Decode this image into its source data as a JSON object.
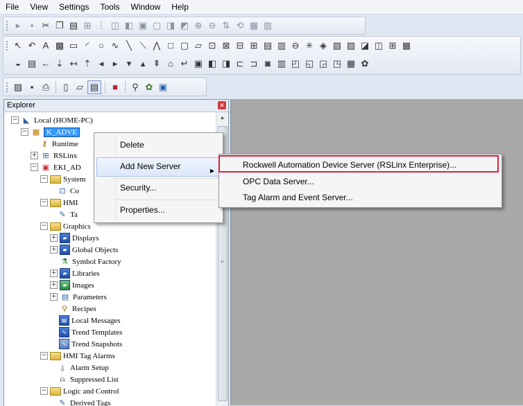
{
  "menubar": {
    "items": [
      "File",
      "View",
      "Settings",
      "Tools",
      "Window",
      "Help"
    ]
  },
  "explorer": {
    "title": "Explorer",
    "tree": {
      "local": "Local (HOME-PC)",
      "app": "K_ADVE",
      "runtime": "Runtime",
      "rslinx": "RSLinx",
      "eki": "EKI_AD",
      "system": "System",
      "co": "Co",
      "hmi": "HMI",
      "ta": "Ta",
      "graphics": "Graphics",
      "displays": "Displays",
      "global_objects": "Global Objects",
      "symbol_factory": "Symbol Factory",
      "libraries": "Libraries",
      "images": "Images",
      "parameters": "Parameters",
      "recipes": "Recipes",
      "local_messages": "Local Messages",
      "trend_templates": "Trend Templates",
      "trend_snapshots": "Trend Snapshots",
      "hmi_tag_alarms": "HMI Tag Alarms",
      "alarm_setup": "Alarm Setup",
      "suppressed_list": "Suppressed List",
      "logic_and_control": "Logic and Control",
      "derived_tags": "Derived Tags"
    }
  },
  "context_menu": {
    "delete": "Delete",
    "add_new_server": "Add New Server",
    "security": "Security...",
    "properties": "Properties..."
  },
  "submenu": {
    "rockwell": "Rockwell Automation Device Server (RSLinx Enterprise)...",
    "opc": "OPC Data Server...",
    "tag_alarm": "Tag Alarm and Event Server..."
  },
  "colors": {
    "highlight_box": "#e0203a",
    "selection": "#3399ff",
    "workspace": "#a9a9a9"
  }
}
